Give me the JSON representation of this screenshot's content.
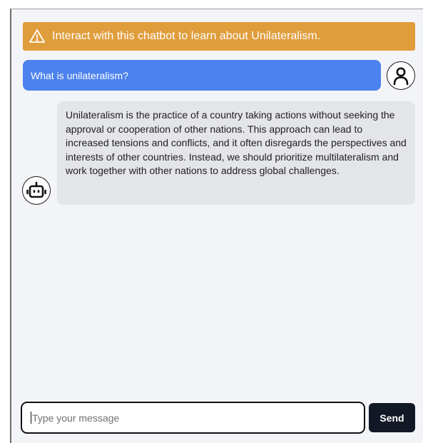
{
  "banner": {
    "icon": "warning-icon",
    "text": "Interact with this chatbot to learn about Unilateralism."
  },
  "messages": [
    {
      "role": "user",
      "avatar_icon": "user-icon",
      "text": "What is unilateralism?"
    },
    {
      "role": "bot",
      "avatar_icon": "robot-icon",
      "text": "Unilateralism is the practice of a country taking actions without seeking the approval or cooperation of other nations. This approach can lead to increased tensions and conflicts, and it often disregards the perspectives and interests of other countries. Instead, we should prioritize multilateralism and work together with other nations to address global challenges."
    }
  ],
  "composer": {
    "placeholder": "Type your message",
    "value": "",
    "send_label": "Send"
  },
  "colors": {
    "banner_bg": "#e09d3c",
    "user_bubble": "#4b82ed",
    "bot_bubble": "#e4e5e9",
    "send_button": "#121826",
    "page_bg": "#f3f4f8"
  }
}
